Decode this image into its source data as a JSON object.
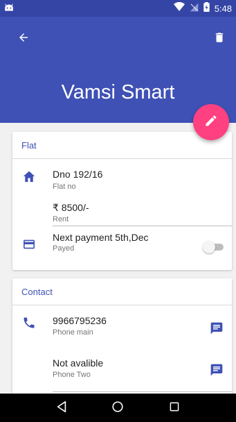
{
  "status_bar": {
    "time": "5:48"
  },
  "header": {
    "title": "Vamsi Smart"
  },
  "colors": {
    "primary": "#3f51b5",
    "primary_dark": "#3445a6",
    "accent": "#ff4081"
  },
  "icons": {
    "back": "arrow-back-icon",
    "delete": "trash-icon",
    "edit": "pencil-icon",
    "home": "home-icon",
    "card": "credit-card-icon",
    "phone": "phone-icon",
    "message": "message-icon"
  },
  "flat_card": {
    "title": "Flat",
    "address": {
      "value": "Dno 192/16",
      "label": "Flat no"
    },
    "rent": {
      "value": "₹ 8500/-",
      "label": "Rent"
    },
    "payment": {
      "value": "Next payment 5th,Dec",
      "label": "Payed",
      "payed": false
    }
  },
  "contact_card": {
    "title": "Contact",
    "phone_main": {
      "value": "9966795236",
      "label": "Phone main"
    },
    "phone_two": {
      "value": "Not avalible",
      "label": "Phone Two"
    }
  }
}
